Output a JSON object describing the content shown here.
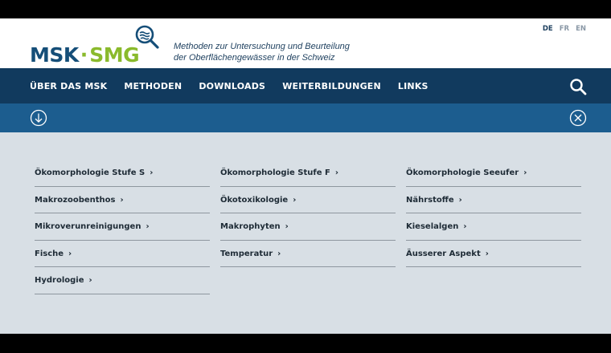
{
  "header": {
    "logo_left": "MSK",
    "logo_separator": "·",
    "logo_right": "SMG",
    "tagline_line1": "Methoden zur Untersuchung und Beurteilung",
    "tagline_line2": "der Oberflächengewässer in der Schweiz",
    "languages": [
      "DE",
      "FR",
      "EN"
    ],
    "active_language": "DE"
  },
  "nav": {
    "items": [
      "ÜBER DAS MSK",
      "METHODEN",
      "DOWNLOADS",
      "WEITERBILDUNGEN",
      "LINKS"
    ]
  },
  "menu": {
    "columns": [
      {
        "items": [
          "Ökomorphologie Stufe S",
          "Makrozoobenthos",
          "Mikroverunreinigungen",
          "Fische",
          "Hydrologie"
        ]
      },
      {
        "items": [
          "Ökomorphologie Stufe F",
          "Ökotoxikologie",
          "Makrophyten",
          "Temperatur"
        ]
      },
      {
        "items": [
          "Ökomorphologie Seeufer",
          "Nährstoffe",
          "Kieselalgen",
          "Äusserer Aspekt"
        ]
      }
    ],
    "chevron": "›"
  },
  "icons": {
    "search": "search-icon",
    "download": "arrow-down-circle-icon",
    "close": "close-circle-icon",
    "logo_mark": "magnifier-water-icon"
  },
  "colors": {
    "nav_bg": "#113a5e",
    "subbar_bg": "#1c5d8f",
    "panel_bg": "#d8dfe5",
    "brand_blue": "#154e78",
    "brand_green": "#8aba2c"
  }
}
